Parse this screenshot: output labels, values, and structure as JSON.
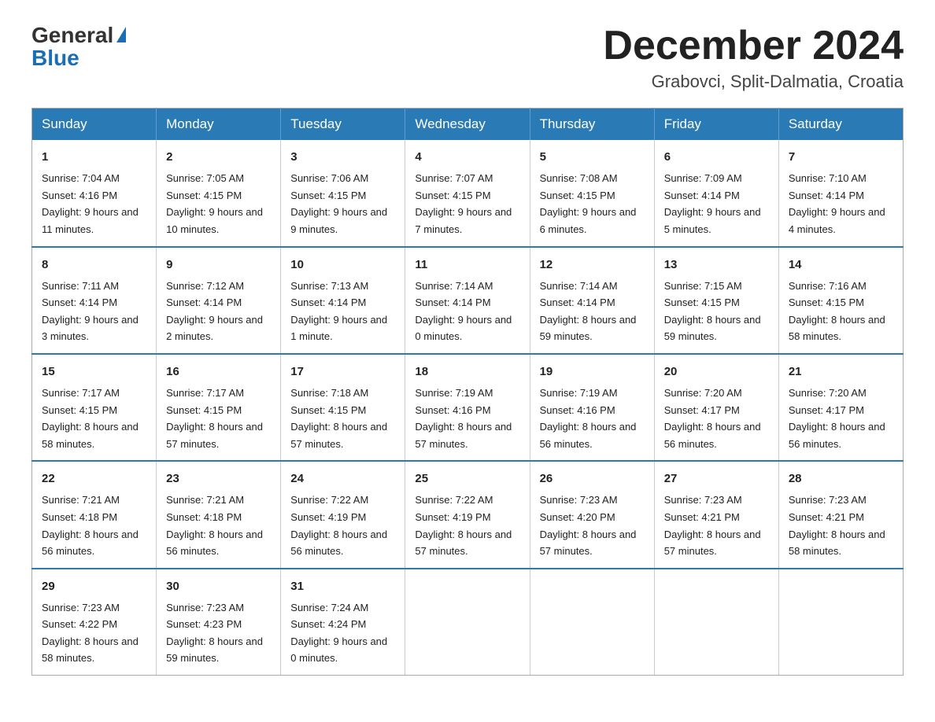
{
  "logo": {
    "general": "General",
    "blue": "Blue"
  },
  "title": "December 2024",
  "location": "Grabovci, Split-Dalmatia, Croatia",
  "days_of_week": [
    "Sunday",
    "Monday",
    "Tuesday",
    "Wednesday",
    "Thursday",
    "Friday",
    "Saturday"
  ],
  "weeks": [
    [
      {
        "day": "1",
        "sunrise": "7:04 AM",
        "sunset": "4:16 PM",
        "daylight": "9 hours and 11 minutes."
      },
      {
        "day": "2",
        "sunrise": "7:05 AM",
        "sunset": "4:15 PM",
        "daylight": "9 hours and 10 minutes."
      },
      {
        "day": "3",
        "sunrise": "7:06 AM",
        "sunset": "4:15 PM",
        "daylight": "9 hours and 9 minutes."
      },
      {
        "day": "4",
        "sunrise": "7:07 AM",
        "sunset": "4:15 PM",
        "daylight": "9 hours and 7 minutes."
      },
      {
        "day": "5",
        "sunrise": "7:08 AM",
        "sunset": "4:15 PM",
        "daylight": "9 hours and 6 minutes."
      },
      {
        "day": "6",
        "sunrise": "7:09 AM",
        "sunset": "4:14 PM",
        "daylight": "9 hours and 5 minutes."
      },
      {
        "day": "7",
        "sunrise": "7:10 AM",
        "sunset": "4:14 PM",
        "daylight": "9 hours and 4 minutes."
      }
    ],
    [
      {
        "day": "8",
        "sunrise": "7:11 AM",
        "sunset": "4:14 PM",
        "daylight": "9 hours and 3 minutes."
      },
      {
        "day": "9",
        "sunrise": "7:12 AM",
        "sunset": "4:14 PM",
        "daylight": "9 hours and 2 minutes."
      },
      {
        "day": "10",
        "sunrise": "7:13 AM",
        "sunset": "4:14 PM",
        "daylight": "9 hours and 1 minute."
      },
      {
        "day": "11",
        "sunrise": "7:14 AM",
        "sunset": "4:14 PM",
        "daylight": "9 hours and 0 minutes."
      },
      {
        "day": "12",
        "sunrise": "7:14 AM",
        "sunset": "4:14 PM",
        "daylight": "8 hours and 59 minutes."
      },
      {
        "day": "13",
        "sunrise": "7:15 AM",
        "sunset": "4:15 PM",
        "daylight": "8 hours and 59 minutes."
      },
      {
        "day": "14",
        "sunrise": "7:16 AM",
        "sunset": "4:15 PM",
        "daylight": "8 hours and 58 minutes."
      }
    ],
    [
      {
        "day": "15",
        "sunrise": "7:17 AM",
        "sunset": "4:15 PM",
        "daylight": "8 hours and 58 minutes."
      },
      {
        "day": "16",
        "sunrise": "7:17 AM",
        "sunset": "4:15 PM",
        "daylight": "8 hours and 57 minutes."
      },
      {
        "day": "17",
        "sunrise": "7:18 AM",
        "sunset": "4:15 PM",
        "daylight": "8 hours and 57 minutes."
      },
      {
        "day": "18",
        "sunrise": "7:19 AM",
        "sunset": "4:16 PM",
        "daylight": "8 hours and 57 minutes."
      },
      {
        "day": "19",
        "sunrise": "7:19 AM",
        "sunset": "4:16 PM",
        "daylight": "8 hours and 56 minutes."
      },
      {
        "day": "20",
        "sunrise": "7:20 AM",
        "sunset": "4:17 PM",
        "daylight": "8 hours and 56 minutes."
      },
      {
        "day": "21",
        "sunrise": "7:20 AM",
        "sunset": "4:17 PM",
        "daylight": "8 hours and 56 minutes."
      }
    ],
    [
      {
        "day": "22",
        "sunrise": "7:21 AM",
        "sunset": "4:18 PM",
        "daylight": "8 hours and 56 minutes."
      },
      {
        "day": "23",
        "sunrise": "7:21 AM",
        "sunset": "4:18 PM",
        "daylight": "8 hours and 56 minutes."
      },
      {
        "day": "24",
        "sunrise": "7:22 AM",
        "sunset": "4:19 PM",
        "daylight": "8 hours and 56 minutes."
      },
      {
        "day": "25",
        "sunrise": "7:22 AM",
        "sunset": "4:19 PM",
        "daylight": "8 hours and 57 minutes."
      },
      {
        "day": "26",
        "sunrise": "7:23 AM",
        "sunset": "4:20 PM",
        "daylight": "8 hours and 57 minutes."
      },
      {
        "day": "27",
        "sunrise": "7:23 AM",
        "sunset": "4:21 PM",
        "daylight": "8 hours and 57 minutes."
      },
      {
        "day": "28",
        "sunrise": "7:23 AM",
        "sunset": "4:21 PM",
        "daylight": "8 hours and 58 minutes."
      }
    ],
    [
      {
        "day": "29",
        "sunrise": "7:23 AM",
        "sunset": "4:22 PM",
        "daylight": "8 hours and 58 minutes."
      },
      {
        "day": "30",
        "sunrise": "7:23 AM",
        "sunset": "4:23 PM",
        "daylight": "8 hours and 59 minutes."
      },
      {
        "day": "31",
        "sunrise": "7:24 AM",
        "sunset": "4:24 PM",
        "daylight": "9 hours and 0 minutes."
      },
      null,
      null,
      null,
      null
    ]
  ],
  "labels": {
    "sunrise": "Sunrise:",
    "sunset": "Sunset:",
    "daylight": "Daylight:"
  }
}
